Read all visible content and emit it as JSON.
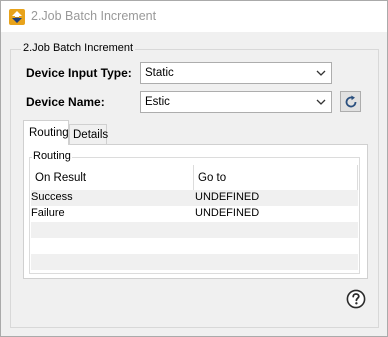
{
  "window": {
    "title": "2.Job Batch Increment",
    "app_icon": "up-down-arrows-icon"
  },
  "group": {
    "legend": "2.Job Batch Increment"
  },
  "fields": {
    "device_input_type": {
      "label": "Device Input Type:",
      "value": "Static"
    },
    "device_name": {
      "label": "Device Name:",
      "value": "Estic"
    }
  },
  "icons": {
    "dropdown": "chevron-down-icon",
    "refresh": "refresh-icon",
    "help": "help-icon"
  },
  "tabs": [
    {
      "label": "Routing",
      "active": true
    },
    {
      "label": "Details",
      "active": false
    }
  ],
  "routing": {
    "legend": "Routing",
    "columns": [
      "On Result",
      "Go to"
    ],
    "rows": [
      {
        "result": "Success",
        "goto": "UNDEFINED"
      },
      {
        "result": "Failure",
        "goto": "UNDEFINED"
      },
      {
        "result": "",
        "goto": ""
      },
      {
        "result": "",
        "goto": ""
      },
      {
        "result": "",
        "goto": ""
      }
    ]
  },
  "colors": {
    "title_text": "#999999",
    "window_bg": "#f0f0f0",
    "stripe": "#f0f0f0",
    "border": "#adadad"
  }
}
